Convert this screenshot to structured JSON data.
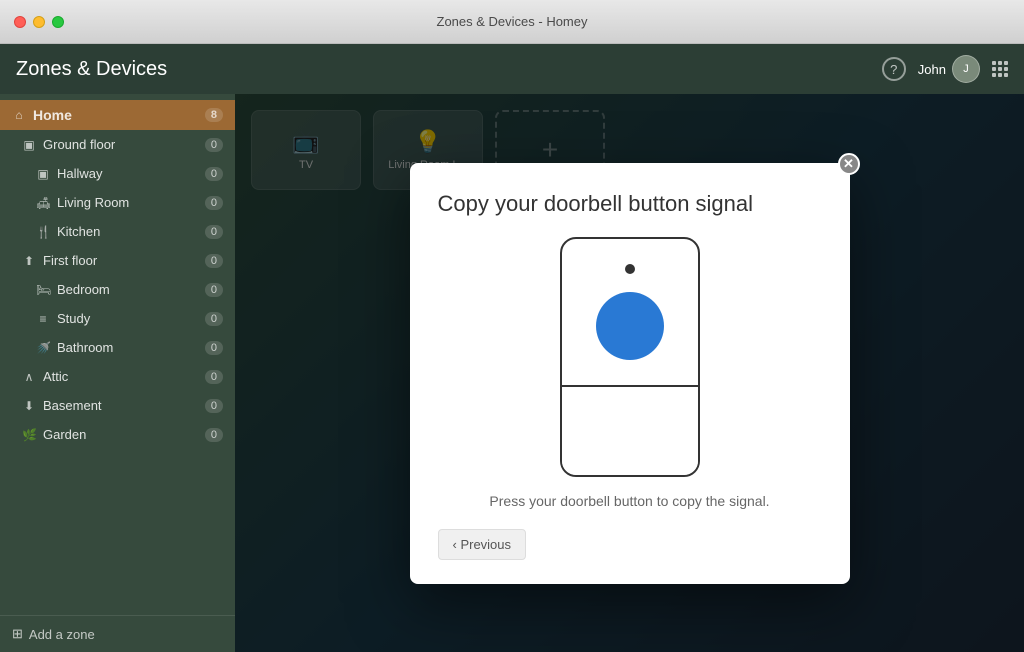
{
  "window": {
    "title": "Zones & Devices - Homey"
  },
  "titlebar": {
    "dot_red": "close",
    "dot_yellow": "minimize",
    "dot_green": "maximize"
  },
  "header": {
    "title": "Zones & Devices",
    "help_label": "?",
    "user_name": "John",
    "grid_label": "apps"
  },
  "sidebar": {
    "items": [
      {
        "id": "home",
        "label": "Home",
        "icon": "⌂",
        "level": 0,
        "count": "8",
        "active": true
      },
      {
        "id": "ground-floor",
        "label": "Ground floor",
        "icon": "▣",
        "level": 1,
        "count": "0"
      },
      {
        "id": "hallway",
        "label": "Hallway",
        "icon": "▣",
        "level": 2,
        "count": "0"
      },
      {
        "id": "living-room",
        "label": "Living Room",
        "icon": "🛋",
        "level": 2,
        "count": "0"
      },
      {
        "id": "kitchen",
        "label": "Kitchen",
        "icon": "🍴",
        "level": 2,
        "count": "0"
      },
      {
        "id": "first-floor",
        "label": "First floor",
        "icon": "⤴",
        "level": 1,
        "count": "0"
      },
      {
        "id": "bedroom",
        "label": "Bedroom",
        "icon": "🛏",
        "level": 2,
        "count": "0"
      },
      {
        "id": "study",
        "label": "Study",
        "icon": "≡",
        "level": 2,
        "count": "0"
      },
      {
        "id": "bathroom",
        "label": "Bathroom",
        "icon": "🚿",
        "level": 2,
        "count": "0"
      },
      {
        "id": "attic",
        "label": "Attic",
        "icon": "^",
        "level": 1,
        "count": "0"
      },
      {
        "id": "basement",
        "label": "Basement",
        "icon": "⤵",
        "level": 1,
        "count": "0"
      },
      {
        "id": "garden",
        "label": "Garden",
        "icon": "🌿",
        "level": 1,
        "count": "0"
      }
    ],
    "add_zone_label": "Add a zone"
  },
  "content": {
    "devices": [
      {
        "id": "tv",
        "icon": "📺",
        "label": "TV"
      },
      {
        "id": "living-room-lamp",
        "icon": "💡",
        "label": "Living Room L..."
      }
    ],
    "add_card_label": "+"
  },
  "modal": {
    "title": "Copy your doorbell button signal",
    "instruction": "Press your doorbell button to copy the signal.",
    "close_label": "✕",
    "previous_label": "‹ Previous",
    "doorbell": {
      "sensor_color": "#333333",
      "button_color": "#2979d4"
    }
  }
}
